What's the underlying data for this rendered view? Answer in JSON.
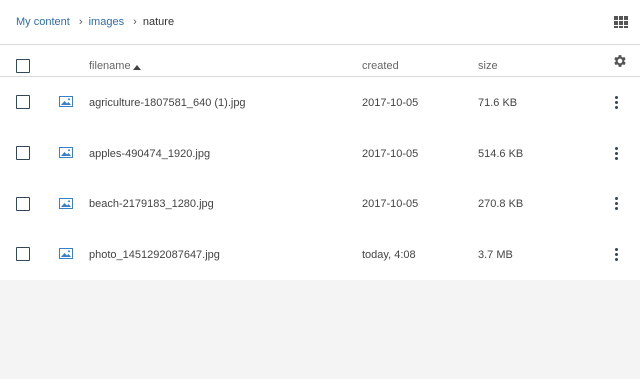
{
  "breadcrumb": {
    "items": [
      {
        "label": "My content",
        "link": true
      },
      {
        "label": "images",
        "link": true
      },
      {
        "label": "nature",
        "link": false
      }
    ],
    "separator": "›"
  },
  "toolbar": {
    "view_toggle_icon": "grid-view-icon",
    "settings_icon": "gear-icon"
  },
  "table": {
    "columns": {
      "filename": "filename",
      "created": "created",
      "size": "size"
    },
    "sort": {
      "column": "filename",
      "direction": "ascending"
    },
    "rows": [
      {
        "filename": "agriculture-1807581_640 (1).jpg",
        "created": "2017-10-05",
        "size": "71.6 KB",
        "icon": "image-file-icon"
      },
      {
        "filename": "apples-490474_1920.jpg",
        "created": "2017-10-05",
        "size": "514.6 KB",
        "icon": "image-file-icon"
      },
      {
        "filename": "beach-2179183_1280.jpg",
        "created": "2017-10-05",
        "size": "270.8 KB",
        "icon": "image-file-icon"
      },
      {
        "filename": "photo_1451292087647.jpg",
        "created": "today, 4:08",
        "size": "3.7 MB",
        "icon": "image-file-icon"
      }
    ]
  },
  "colors": {
    "link": "#2f6da4",
    "icon_blue": "#3b7fc4",
    "background": "#f4f4f4",
    "border": "#d9d9d9"
  }
}
